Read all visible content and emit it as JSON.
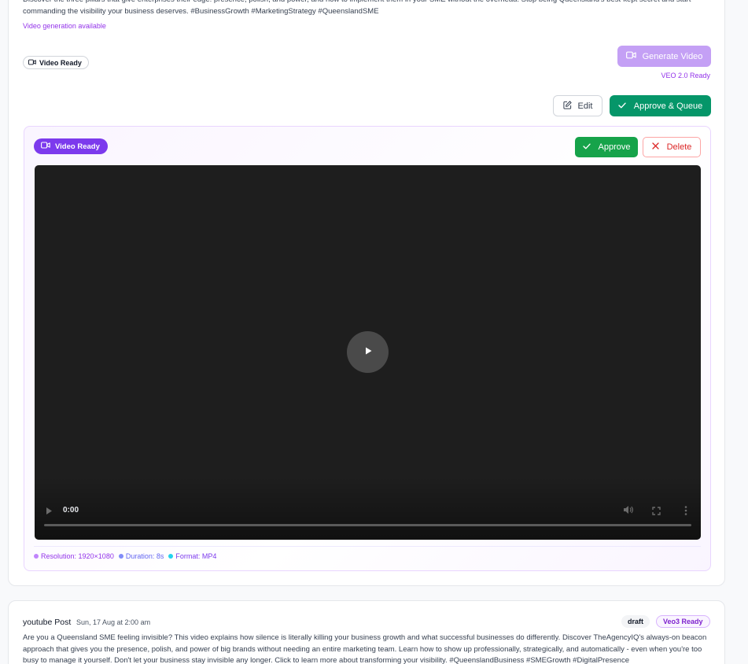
{
  "post1": {
    "description": "Discover the three pillars that give enterprises their edge: presence, polish, and power, and how to implement them in your SME without the overhead. Stop being Queensland's best-kept secret and start commanding the visibility your business deserves. #BusinessGrowth #MarketingStrategy #QueenslandSME",
    "video_generation_note": "Video generation available",
    "status_pill": "Video Ready",
    "generate_video_label": "Generate Video",
    "veo_status": "VEO 2.0 Ready",
    "edit_label": "Edit",
    "approve_queue_label": "Approve & Queue",
    "video_panel": {
      "badge": "Video Ready",
      "approve_label": "Approve",
      "delete_label": "Delete",
      "player": {
        "time": "0:00",
        "progress": 0
      },
      "meta": [
        {
          "label": "Resolution: 1920×1080",
          "color": "#c084fc",
          "text_color": "#9333ea"
        },
        {
          "label": "Duration: 8s",
          "color": "#818cf8",
          "text_color": "#6366f1"
        },
        {
          "label": "Format: MP4",
          "color": "#22d3ee",
          "text_color": "#7c3aed"
        }
      ]
    }
  },
  "post2": {
    "title": "youtube Post",
    "date": "Sun, 17 Aug at 2:00 am",
    "status": "draft",
    "veo_badge": "Veo3 Ready",
    "body": "Are you a Queensland SME feeling invisible? This video explains how silence is literally killing your business growth and what successful businesses do differently. Discover TheAgencyIQ's always-on beacon approach that gives you the presence, polish, and power of big brands without needing an entire marketing team. Learn how to show up professionally, strategically, and automatically - even when you're too busy to manage it yourself. Don't let your business stay invisible any longer. Click to learn more about transforming your visibility. #QueenslandBusiness #SMEGrowth #DigitalPresence"
  },
  "colors": {
    "accent_purple": "#7c3aed",
    "approve_green": "#16a34a",
    "queue_green": "#059669",
    "delete_red": "#dc2626"
  }
}
